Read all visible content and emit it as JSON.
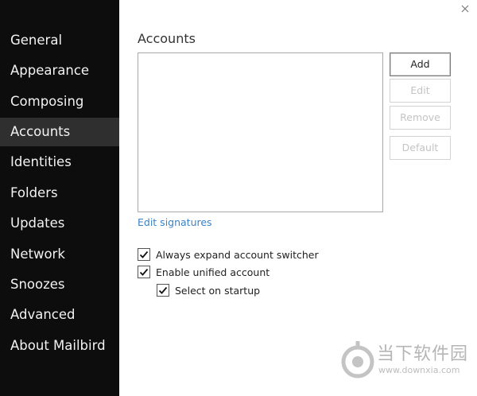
{
  "sidebar": {
    "items": [
      {
        "label": "General"
      },
      {
        "label": "Appearance"
      },
      {
        "label": "Composing"
      },
      {
        "label": "Accounts",
        "active": true
      },
      {
        "label": "Identities"
      },
      {
        "label": "Folders"
      },
      {
        "label": "Updates"
      },
      {
        "label": "Network"
      },
      {
        "label": "Snoozes"
      },
      {
        "label": "Advanced"
      },
      {
        "label": "About Mailbird"
      }
    ]
  },
  "main": {
    "title": "Accounts",
    "buttons": {
      "add": "Add",
      "edit": "Edit",
      "remove": "Remove",
      "default": "Default"
    },
    "edit_signatures": "Edit signatures",
    "options": [
      {
        "label": "Always expand account switcher",
        "checked": true
      },
      {
        "label": "Enable unified account",
        "checked": true
      },
      {
        "label": "Select on startup",
        "checked": true
      }
    ]
  },
  "icons": {
    "close": "close-icon",
    "checkmark": "checkmark-icon",
    "watermark_logo": "watermark-logo-icon"
  },
  "watermark": {
    "text": "当下软件园",
    "url": "www.downxia.com"
  },
  "colors": {
    "sidebar_bg": "#0d0d0d",
    "sidebar_active": "#2f2f2f",
    "link": "#3b82c4"
  }
}
